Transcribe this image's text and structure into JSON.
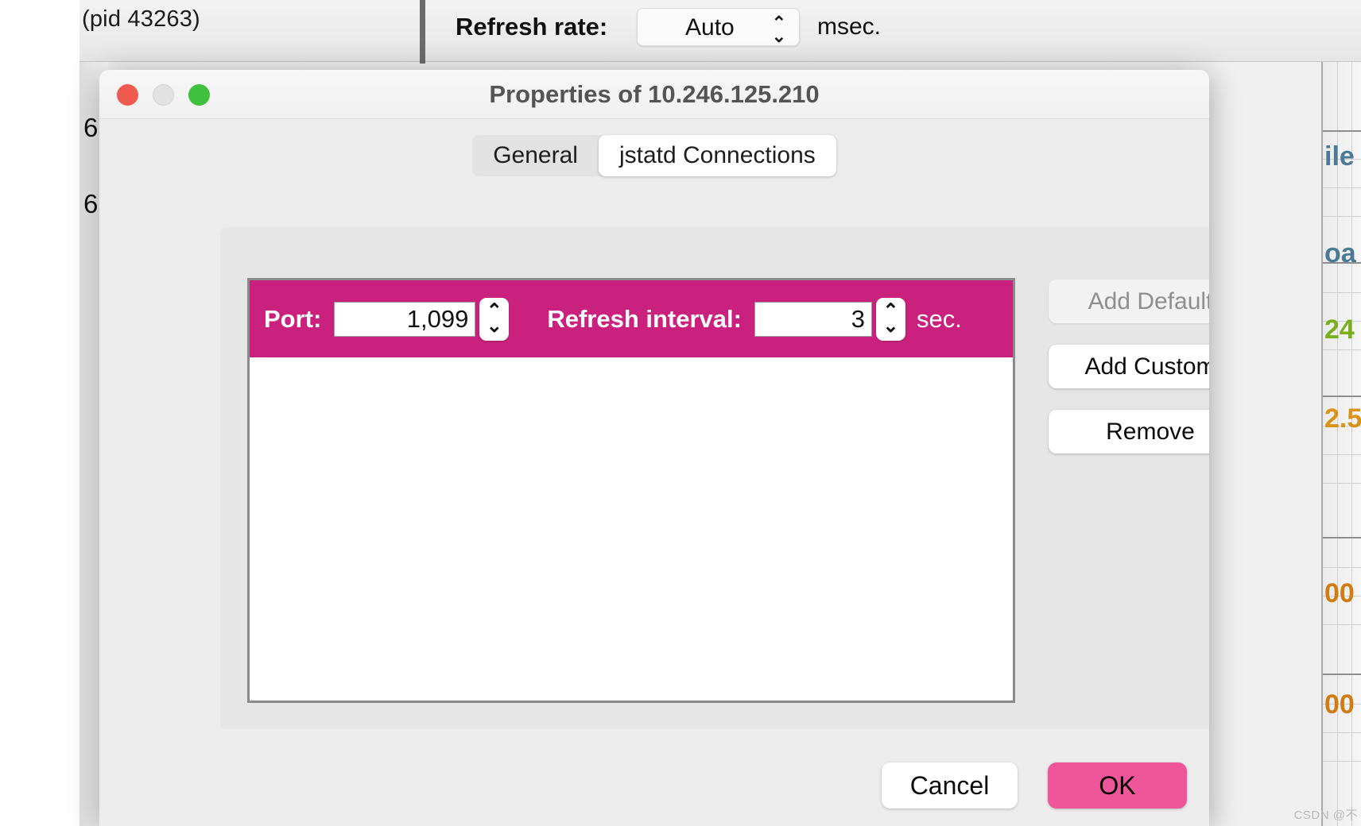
{
  "background_app": {
    "pid_label": "(pid 43263)",
    "refresh_rate_label": "Refresh rate:",
    "refresh_rate_value": "Auto",
    "refresh_rate_unit": "msec.",
    "stepper_icon": "up-down-chevron-icon",
    "axis_ticks": [
      "6",
      "6"
    ],
    "chart_sliver_labels": [
      "ile",
      "oa",
      "24",
      "2.5",
      "00",
      "00"
    ],
    "chart_sliver_colors": [
      "#4a7a96",
      "#4a7a96",
      "#7aae1e",
      "#d99317",
      "#d07c12",
      "#d07c12"
    ]
  },
  "dialog": {
    "title": "Properties of 10.246.125.210",
    "traffic_lights": [
      "close-light",
      "minimize-light",
      "zoom-light"
    ],
    "tabs": [
      {
        "label": "General",
        "active": false
      },
      {
        "label": "jstatd Connections",
        "active": true
      }
    ],
    "connection_row": {
      "port_label": "Port:",
      "port_value": "1,099",
      "refresh_interval_label": "Refresh interval:",
      "refresh_interval_value": "3",
      "refresh_interval_unit": "sec.",
      "selected_color": "#c9217d",
      "stepper_up_glyph": "⌃",
      "stepper_down_glyph": "⌄"
    },
    "side_buttons": [
      {
        "label": "Add Default",
        "enabled": false
      },
      {
        "label": "Add Custom",
        "enabled": true
      },
      {
        "label": "Remove",
        "enabled": true
      }
    ],
    "footer_buttons": {
      "cancel_label": "Cancel",
      "ok_label": "OK",
      "ok_color": "#ef5699"
    }
  },
  "watermark": "CSDN @不"
}
